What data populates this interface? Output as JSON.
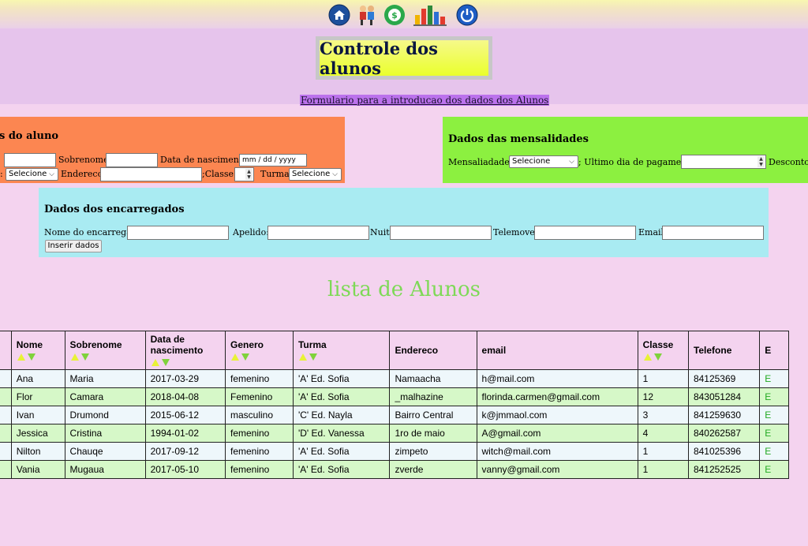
{
  "nav": {
    "icons": [
      "home-icon",
      "students-icon",
      "payment-icon",
      "chart-icon",
      "power-icon"
    ]
  },
  "header": {
    "title": "Controle dos alunos",
    "subtitle": "Formulario para a introducao dos dados dos Alunos"
  },
  "aluno": {
    "heading": "s do aluno",
    "sobrenome_label": "Sobrenome:",
    "nascimento_label": "Data de nascimento:",
    "date_placeholder": "mm / dd / yyyy",
    "genero_label": ":",
    "genero_value": "Selecione",
    "endereco_label": "Endereco:",
    "classe_label": ";Classe:",
    "turma_label": "Turma:",
    "turma_value": "Selecione"
  },
  "mensalidades": {
    "heading": "Dados das mensalidades",
    "mens_label": "Mensaliadades:",
    "mens_value": "Selecione",
    "ultimo_label": "; Ultimo dia de pagamento :",
    "desconto_label": "Desconto:"
  },
  "encarregados": {
    "heading": "Dados dos encarregados",
    "nome_label": "Nome do encarregado:",
    "apelido_label": "Apelido:",
    "nuit_label": "Nuit:",
    "telemovel_label": "Telemovel:",
    "email_label": "Email:",
    "insert_button": "Inserir dados"
  },
  "list_title": "lista de Alunos",
  "table": {
    "headers": [
      "",
      "Nome",
      "Sobrenome",
      "Data de nascimento",
      "Genero",
      "Turma",
      "Endereco",
      "email",
      "Classe",
      "Telefone",
      "E"
    ],
    "rows": [
      [
        "",
        "Ana",
        "Maria",
        "2017-03-29",
        "femenino",
        "'A' Ed. Sofia",
        "Namaacha",
        "h@mail.com",
        "1",
        "84125369",
        "E"
      ],
      [
        "",
        "Flor",
        "Camara",
        "2018-04-08",
        "Femenino",
        "'A' Ed. Sofia",
        "_malhazine",
        "florinda.carmen@gmail.com",
        "12",
        "843051284",
        "E"
      ],
      [
        "",
        "Ivan",
        "Drumond",
        "2015-06-12",
        "masculino",
        "'C' Ed. Nayla",
        "Bairro Central",
        "k@jmmaol.com",
        "3",
        "841259630",
        "E"
      ],
      [
        "",
        "Jessica",
        "Cristina",
        "1994-01-02",
        "femenino",
        "'D' Ed. Vanessa",
        "1ro de maio",
        "A@gmail.com",
        "4",
        "840262587",
        "E"
      ],
      [
        "",
        "Nilton",
        "Chauqe",
        "2017-09-12",
        "femenino",
        "'A' Ed. Sofia",
        "zimpeto",
        "witch@mail.com",
        "1",
        "841025396",
        "E"
      ],
      [
        "",
        "Vania",
        "Mugaua",
        "2017-05-10",
        "femenino",
        "'A' Ed. Sofia",
        "zverde",
        "vanny@gmail.com",
        "1",
        "841252525",
        "E"
      ]
    ]
  },
  "colors": {
    "page_bg": "#f4d3ef",
    "aluno_panel": "#fc8651",
    "mens_panel": "#8cf040",
    "enc_panel": "#a9ebf2",
    "list_title": "#7ed957",
    "row_light": "#eef7fb",
    "row_green": "#d6f8c8"
  }
}
